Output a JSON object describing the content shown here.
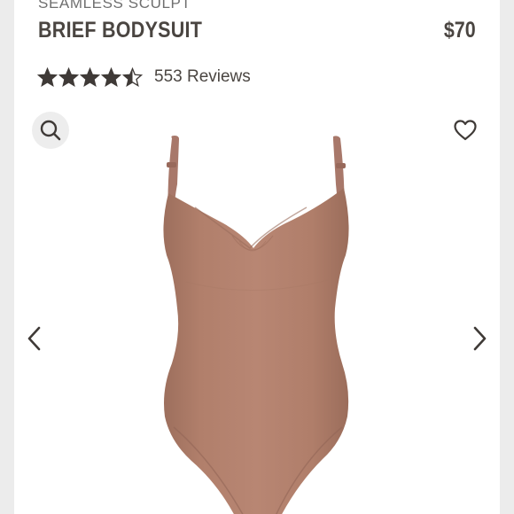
{
  "product": {
    "collection": "SEAMLESS SCULPT",
    "name": "BRIEF BODYSUIT",
    "price": "$70"
  },
  "rating": {
    "stars": 4.5,
    "max_stars": 5,
    "reviews_label": "553 Reviews"
  },
  "icons": {
    "search": "search-icon",
    "wishlist": "heart-outline-icon",
    "previous": "chevron-left-icon",
    "next": "chevron-right-icon"
  },
  "colors": {
    "text": "#4a4541",
    "product_fabric": "#ab7b67",
    "search_bg": "#ededed"
  }
}
